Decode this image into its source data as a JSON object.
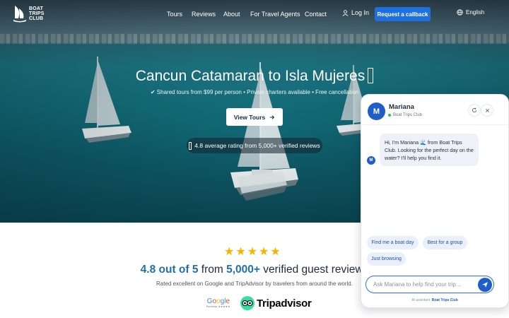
{
  "brand": {
    "logo_lines": [
      "BOAT",
      "TRIPS",
      "CLUB"
    ]
  },
  "nav": {
    "links": [
      "Tours",
      "Reviews",
      "About",
      "For Travel Agents",
      "Contact"
    ],
    "login": "Log In",
    "callback": "Request a callback",
    "language": "English"
  },
  "hero": {
    "title": "Cancun Catamaran to Isla Mujeres",
    "subtitle": "✔ Shared tours from $99 per person • Private charters available • Free cancellation",
    "cta": "View Tours",
    "rating_pill": "4.8 average rating from 5,000+ verified reviews"
  },
  "reviews": {
    "stars": 5,
    "rating_value": "4.8 out of 5",
    "from_word": " from ",
    "count": "5,000+",
    "rest": " verified guest reviews",
    "subtitle": "Rated excellent on Google and TripAdvisor by travelers from around the world.",
    "google_word": "Google",
    "google_sub": "Reviews ★★★★★",
    "tripadvisor": "Tripadvisor"
  },
  "chat": {
    "avatar_letter": "M",
    "name": "Mariana",
    "org": "Boat Trips Club",
    "message": "Hi, I'm Mariana 🌊 from Boat Trips Club. Looking for the perfect day on the water? I'll help you find it.",
    "chips": [
      "Find me a boat day",
      "Best for a group",
      "Just browsing"
    ],
    "input_placeholder": "Ask Mariana to help find your trip...",
    "footer_prefix": "AI assistant",
    "footer_brand": "Boat Trips Club"
  },
  "colors": {
    "primary": "#1e6fe0",
    "accent_text": "#1f6fb0",
    "star": "#f4b400",
    "tripadvisor": "#34e0a1"
  }
}
